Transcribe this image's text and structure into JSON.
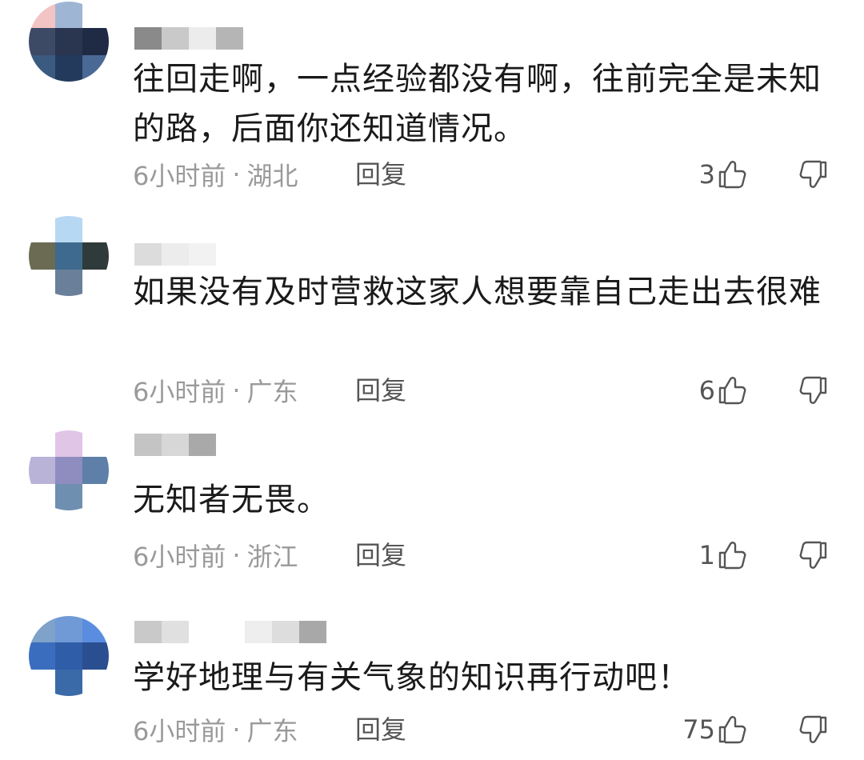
{
  "comments": [
    {
      "text": "往回走啊，一点经验都没有啊，往前完全是未知的路，后面你还知道情况。",
      "time": "6小时前",
      "location": "湖北",
      "reply_label": "回复",
      "likes": "3",
      "avatar_colors": [
        "#f3c4c4",
        "#9fb5d4",
        "#ffffff",
        "#3c4a66",
        "#2a3550",
        "#1f2b45",
        "#3a5a80",
        "#233a5c",
        "#4a6a95"
      ]
    },
    {
      "text": "如果没有及时营救这家人想要靠自己走出去很难",
      "time": "6小时前",
      "location": "广东",
      "reply_label": "回复",
      "likes": "6",
      "avatar_colors": [
        "#ffffff",
        "#b7d8f3",
        "#ffffff",
        "#6b6a52",
        "#3e6a8f",
        "#2f3b3a",
        "#ffffff",
        "#6a7f99",
        "#ffffff"
      ]
    },
    {
      "text": "无知者无畏。",
      "time": "6小时前",
      "location": "浙江",
      "reply_label": "回复",
      "likes": "1",
      "avatar_colors": [
        "#ffffff",
        "#e0c5e7",
        "#ffffff",
        "#b9b3d8",
        "#8f8cc0",
        "#5d7fa8",
        "#ffffff",
        "#6f8fb0",
        "#ffffff"
      ]
    },
    {
      "text": "学好地理与有关气象的知识再行动吧！",
      "time": "6小时前",
      "location": "广东",
      "reply_label": "回复",
      "likes": "75",
      "avatar_colors": [
        "#7ea2c9",
        "#6f9ad6",
        "#5a8de0",
        "#3a6dbd",
        "#2f5da8",
        "#2a4f90",
        "#ffffff",
        "#3a6aa8",
        "#ffffff"
      ]
    }
  ],
  "separator": "·",
  "colors": {
    "text": "#1a1a1a",
    "meta": "#9a9a9a",
    "action": "#555555"
  }
}
